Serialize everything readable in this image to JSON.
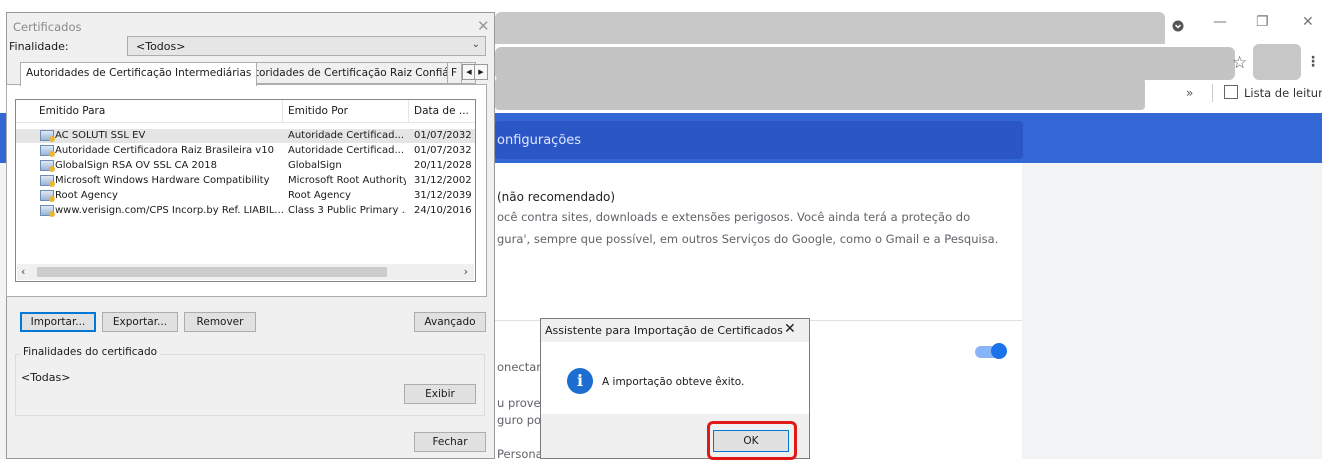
{
  "browser": {
    "reading_list_label": "Lista de leitura",
    "bookmarks_overflow": "»",
    "star_icon": "star-icon",
    "menu_icon": "⋮"
  },
  "settings": {
    "header_text": "onfigurações",
    "option_title": "(não recomendado)",
    "option_desc_1": "ocê contra sites, downloads e extensões perigosos. Você ainda terá a proteção do",
    "option_desc_2": "gura', sempre que possível, em outros Serviços do Google, como o Gmail e a Pesquisa.",
    "frag_1": "onectar",
    "frag_2": "u proved",
    "frag_3": "guro po",
    "frag_4": "Persona"
  },
  "cert_dialog": {
    "title": "Certificados",
    "purpose_label": "Finalidade:",
    "purpose_value": "<Todos>",
    "tabs": [
      {
        "label": "Autoridades de Certificação Intermediárias"
      },
      {
        "label": "Autoridades de Certificação Raiz Confiáveis"
      },
      {
        "label": "F"
      }
    ],
    "columns": [
      "Emitido Para",
      "Emitido Por",
      "Data de ..."
    ],
    "rows": [
      {
        "to": "AC SOLUTI SSL EV",
        "by": "Autoridade Certificad...",
        "date": "01/07/2032"
      },
      {
        "to": "Autoridade Certificadora Raiz Brasileira v10",
        "by": "Autoridade Certificad...",
        "date": "01/07/2032"
      },
      {
        "to": "GlobalSign RSA OV SSL CA 2018",
        "by": "GlobalSign",
        "date": "20/11/2028"
      },
      {
        "to": "Microsoft Windows Hardware Compatibility",
        "by": "Microsoft Root Authority",
        "date": "31/12/2002"
      },
      {
        "to": "Root Agency",
        "by": "Root Agency",
        "date": "31/12/2039"
      },
      {
        "to": "www.verisign.com/CPS Incorp.by Ref. LIABIL...",
        "by": "Class 3 Public Primary ...",
        "date": "24/10/2016"
      }
    ],
    "buttons": {
      "import": "Importar...",
      "export": "Exportar...",
      "remove": "Remover",
      "advanced": "Avançado",
      "view": "Exibir",
      "close": "Fechar"
    },
    "purposes_group_title": "Finalidades do certificado",
    "purposes_value": "<Todas>"
  },
  "wizard": {
    "title": "Assistente para Importação de Certificados",
    "message": "A importação obteve êxito.",
    "ok_label": "OK"
  },
  "colors": {
    "settings_blue": "#3367d6",
    "highlight_red": "#e01818",
    "info_blue": "#1c6fd0",
    "toggle_blue": "#1a73e8"
  }
}
